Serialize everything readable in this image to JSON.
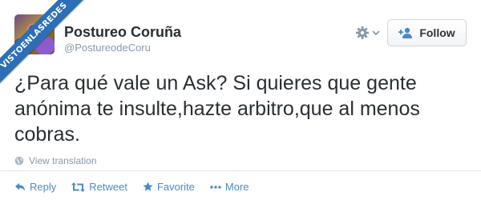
{
  "watermark": {
    "text": "VISTOENLASREDES"
  },
  "user": {
    "name": "Postureo Coruña",
    "handle": "@PostureodeCoru",
    "avatar_icon": "app-logo-avatar"
  },
  "follow_button": {
    "label": "Follow",
    "icon": "add-user-icon"
  },
  "settings_icon": "gear-icon",
  "tweet": {
    "lines": [
      "¿Para qué vale un Ask? Si quieres que gente",
      "anónima te insulte,hazte arbitro,que al menos",
      "cobras."
    ]
  },
  "translation": {
    "label": "View translation",
    "icon": "globe-icon"
  },
  "actions": {
    "reply": "Reply",
    "retweet": "Retweet",
    "favorite": "Favorite",
    "more": "More"
  },
  "colors": {
    "accent": "#4a8ac7",
    "text": "#292f33",
    "muted": "#8899a6",
    "ribbon": "#2d6fb6"
  }
}
